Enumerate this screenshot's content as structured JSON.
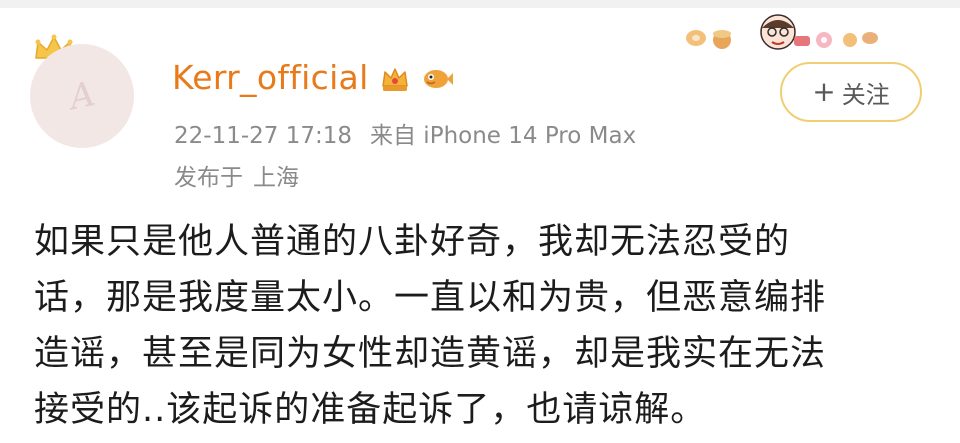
{
  "user": {
    "name": "Kerr_official",
    "timestamp": "22-11-27 17:18",
    "source": "来自 iPhone 14 Pro Max",
    "location_prefix": "发布于",
    "location": "上海",
    "avatar_mark": "A"
  },
  "follow_button": {
    "plus": "+",
    "label": "关注"
  },
  "post": {
    "lines": [
      "如果只是他人普通的八卦好奇，我却无法忍受的",
      "话，那是我度量太小。一直以和为贵，但恶意编排",
      "造谣，甚至是同为女性却造黄谣，却是我实在无法",
      "接受的..该起诉的准备起诉了，也请谅解。"
    ]
  },
  "icons": [
    "crown-icon",
    "vip-crown-icon",
    "fish-icon",
    "sticker-strip"
  ],
  "colors": {
    "username": "#e97a1a",
    "meta": "#8a8a8a",
    "follow_border": "#f0ce73",
    "text": "#1c1c1c"
  }
}
